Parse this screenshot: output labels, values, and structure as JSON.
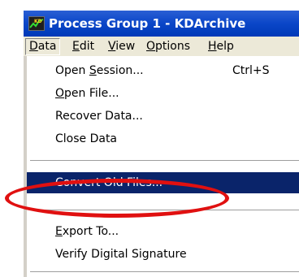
{
  "window": {
    "title": "Process Group 1 - KDArchive",
    "icon": "kd-app-icon"
  },
  "menubar": [
    {
      "key": "data",
      "first": "D",
      "rest": "ata",
      "active": true
    },
    {
      "key": "edit",
      "first": "E",
      "rest": "dit"
    },
    {
      "key": "view",
      "first": "V",
      "rest": "iew"
    },
    {
      "key": "options",
      "first": "O",
      "rest": "ptions"
    },
    {
      "key": "help",
      "first": "H",
      "rest": "elp"
    }
  ],
  "dropdown": {
    "open_session": {
      "pre": "Open ",
      "u": "S",
      "post": "ession...",
      "shortcut": "Ctrl+S"
    },
    "open_file": {
      "pre": "",
      "u": "O",
      "post": "pen File..."
    },
    "recover_data": {
      "label": "Recover Data..."
    },
    "close_data": {
      "label": "Close Data"
    },
    "convert_old_files": {
      "label": "Convert Old Files...",
      "highlighted": true
    },
    "export_to": {
      "pre": "",
      "u": "E",
      "post": "xport To..."
    },
    "verify_signature": {
      "label": "Verify Digital Signature"
    }
  },
  "annotation": {
    "color": "#e01010"
  },
  "colors": {
    "titlebar": "#0a46c8",
    "selection": "#0a246a",
    "menu_bg": "#ece9d8"
  }
}
